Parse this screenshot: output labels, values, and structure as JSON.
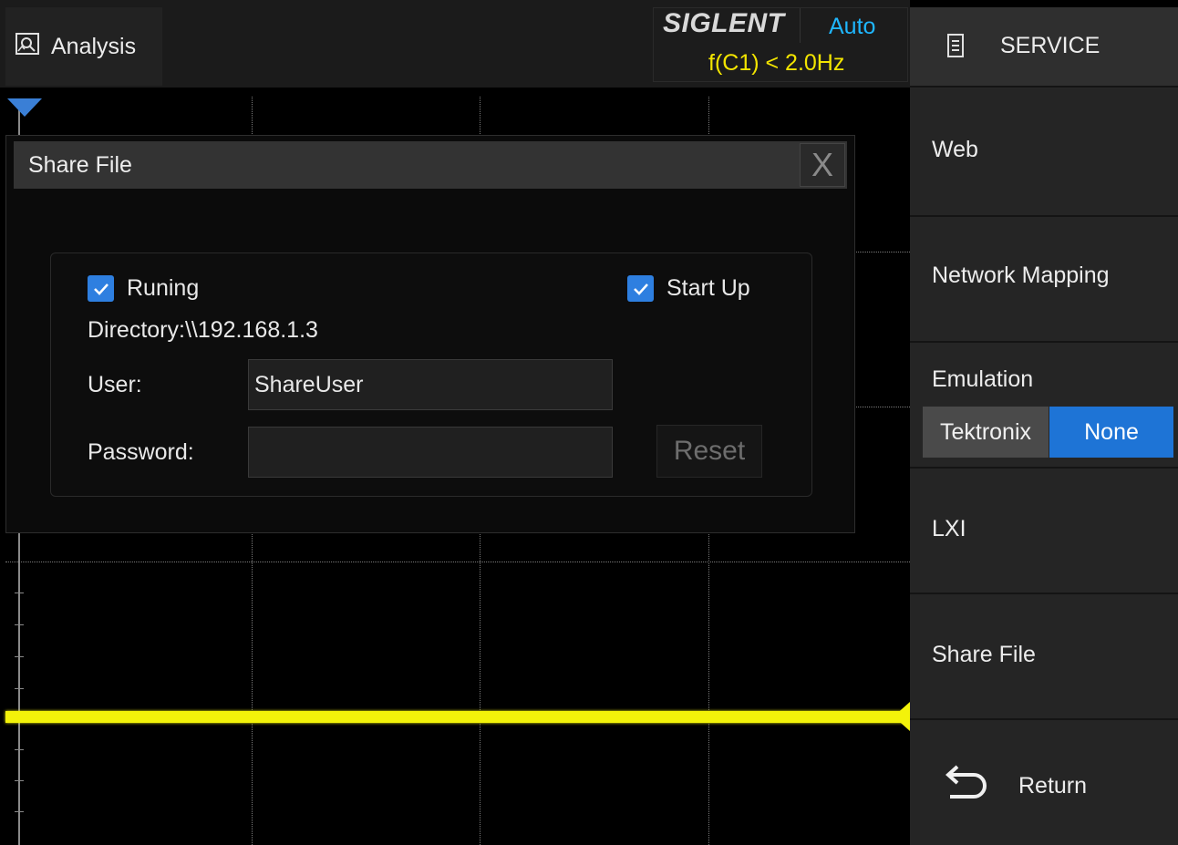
{
  "header": {
    "analysis_label": "Analysis",
    "brand": "SIGLENT",
    "trigger_mode": "Auto",
    "trigger_info": "f(C1) < 2.0Hz"
  },
  "dialog": {
    "title": "Share File",
    "close_glyph": "X",
    "running_label": "Runing",
    "running_checked": true,
    "startup_label": "Start Up",
    "startup_checked": true,
    "directory": "Directory:\\\\192.168.1.3",
    "user_label": "User:",
    "user_value": "ShareUser",
    "password_label": "Password:",
    "password_value": "",
    "reset_label": "Reset"
  },
  "menu": {
    "title": "SERVICE",
    "items": {
      "web": "Web",
      "network_mapping": "Network Mapping",
      "emulation": "Emulation",
      "emulation_options": [
        "Tektronix",
        "None"
      ],
      "emulation_selected": "None",
      "lxi": "LXI",
      "share_file": "Share File",
      "return": "Return"
    }
  },
  "colors": {
    "accent_blue": "#1e74d6",
    "trace_yellow": "#f3f20a",
    "trigger_yellow": "#f2e400",
    "mode_cyan": "#1fb7ff"
  }
}
